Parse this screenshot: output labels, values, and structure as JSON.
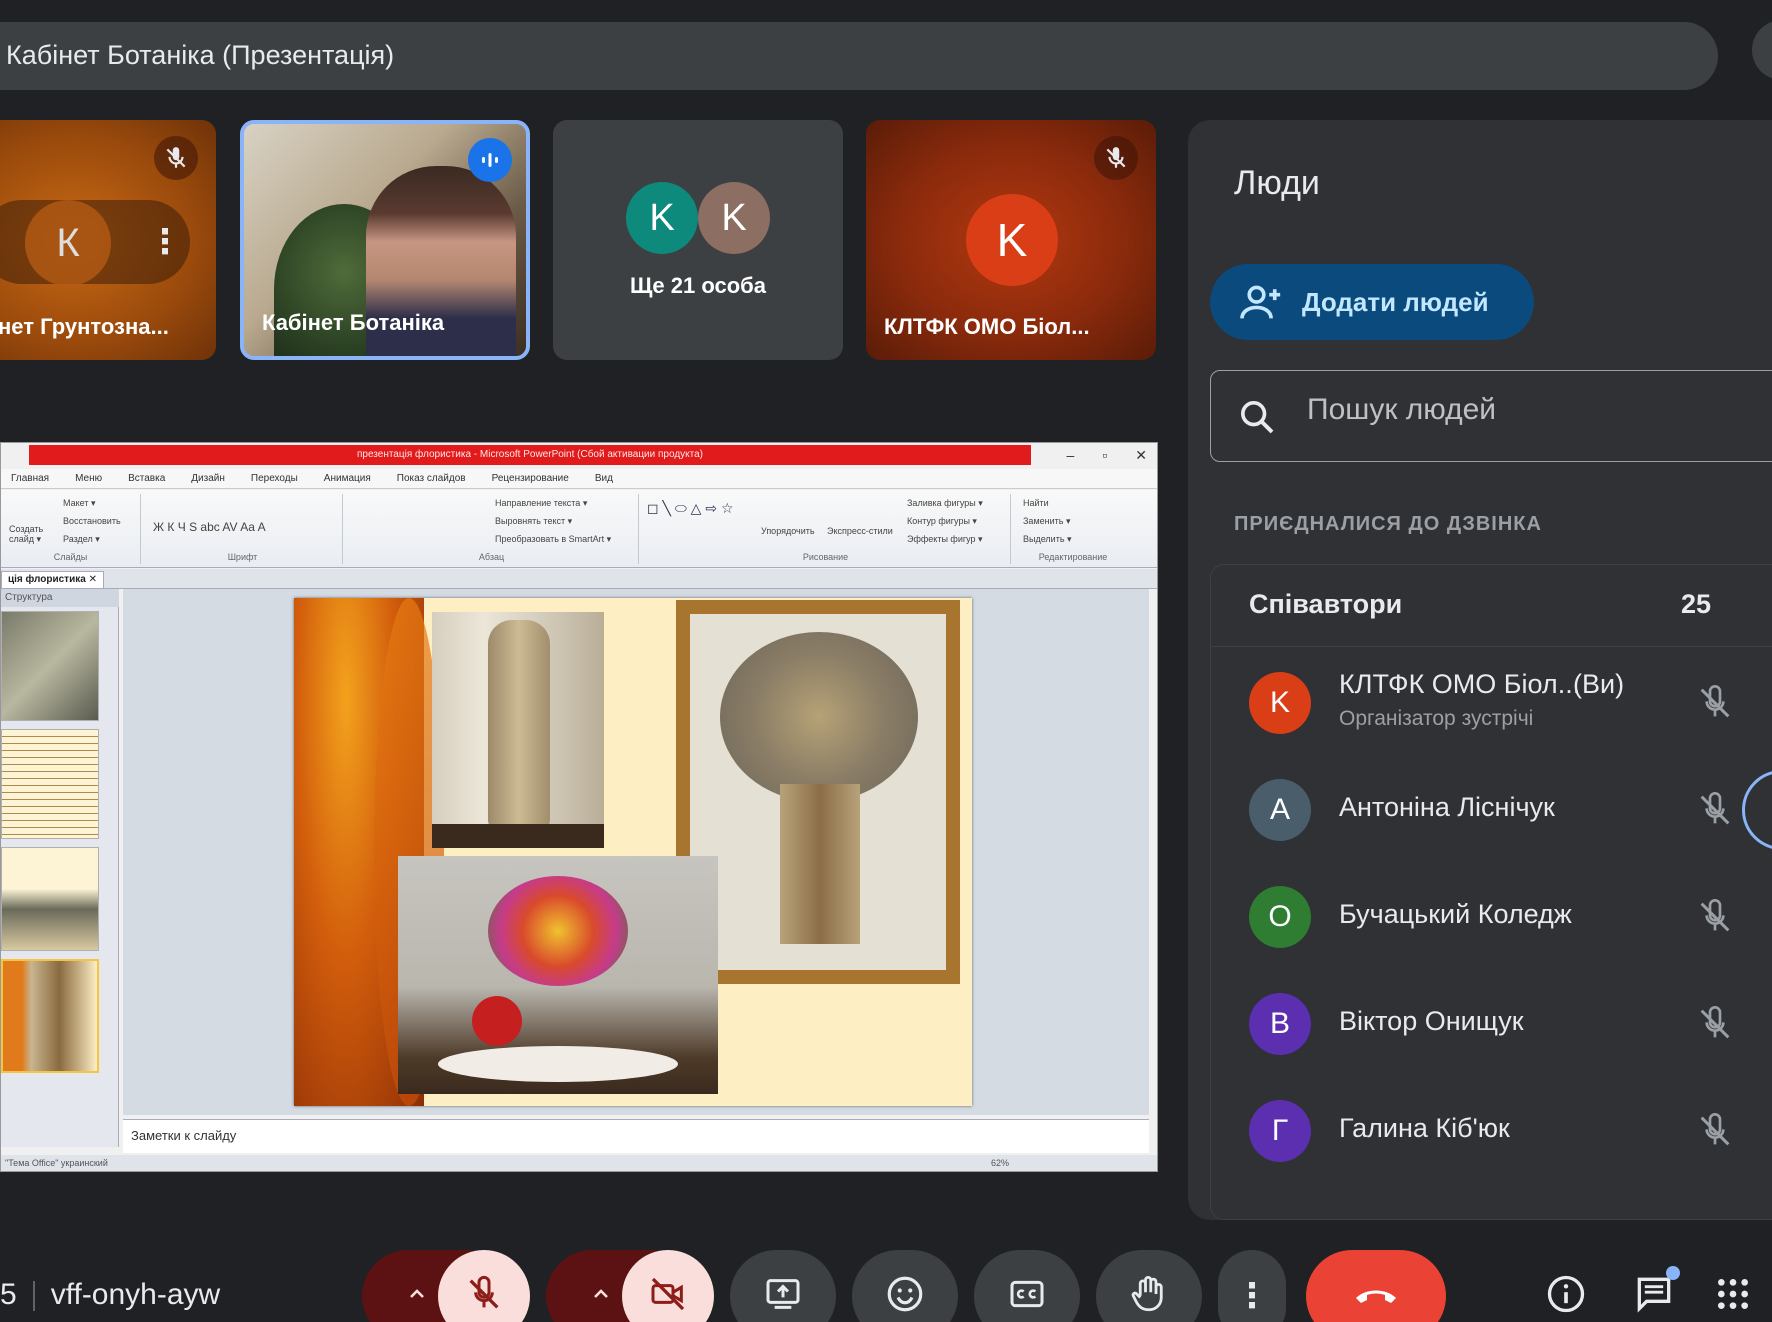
{
  "meeting": {
    "title": "Кабінет Ботаніка (Презентація)",
    "code_prefix": "5",
    "code": "vff-onyh-ayw"
  },
  "tiles": [
    {
      "name": "нет Грунтозна...",
      "avatar_letter": "К"
    },
    {
      "name": "Кабінет Ботаніка"
    },
    {
      "more_text": "Ще 21 особа",
      "avatar_letters": [
        "K",
        "K"
      ]
    },
    {
      "name": "КЛТФК ОМО Біол...",
      "avatar_letter": "K"
    }
  ],
  "presentation": {
    "window_title": "презентація флористика - Microsoft PowerPoint (Сбой активации продукта)",
    "menu_tabs": [
      "Главная",
      "Меню",
      "Вставка",
      "Дизайн",
      "Переходы",
      "Анимация",
      "Показ слайдов",
      "Рецензирование",
      "Вид"
    ],
    "ribbon_groups": [
      "Слайды",
      "Шрифт",
      "Абзац",
      "Рисование",
      "Редактирование"
    ],
    "ribbon_items": {
      "maket": "Макет ▾",
      "vosst": "Восстановить",
      "razdel": "Раздел ▾",
      "create": "Создать слайд ▾",
      "napr": "Направление текста ▾",
      "vyr": "Выровнять текст ▾",
      "smart": "Преобразовать в SmartArt ▾",
      "upor": "Упорядочить",
      "express": "Экспресс-стили",
      "zalivka": "Заливка фигуры ▾",
      "kontur": "Контур фигуры ▾",
      "effekty": "Эффекты фигур ▾",
      "nayti": "Найти",
      "zamenit": "Заменить ▾",
      "vydelit": "Выделить ▾"
    },
    "doc_tab": "ція флористика",
    "pane_tab": "Структура",
    "notes_text": "Заметки к слайду",
    "status_left": "\"Тема Office\"   украинский",
    "zoom": "62%"
  },
  "people_panel": {
    "title": "Люди",
    "add_button": "Додати людей",
    "search_placeholder": "Пошук людей",
    "section_label": "ПРИЄДНАЛИСЯ ДО ДЗВІНКА",
    "group_name": "Співавтори",
    "group_count": "25",
    "you_label": "(Ви)",
    "participants": [
      {
        "letter": "K",
        "name": "КЛТФК ОМО Біол...",
        "role": "Організатор зустрічі",
        "color": "#d93e17"
      },
      {
        "letter": "A",
        "name": "Антоніна Ліснічук",
        "color": "#4a5d6b"
      },
      {
        "letter": "O",
        "name": "Бучацький Коледж",
        "color": "#2e7d32"
      },
      {
        "letter": "B",
        "name": "Віктор Онищук",
        "color": "#5b2fb0"
      },
      {
        "letter": "Г",
        "name": "Галина Кіб'юк",
        "color": "#5b2fb0"
      }
    ]
  },
  "controls": {
    "mic": "mic-off",
    "camera": "camera-off",
    "present": "present-now",
    "emoji": "emoji",
    "captions": "captions",
    "raise_hand": "raise-hand",
    "more": "more-options",
    "end_call": "leave-call",
    "info": "meeting-details",
    "chat": "chat",
    "activities": "activities"
  },
  "colors": {
    "background": "#202124",
    "surface": "#303134",
    "accent_blue": "#8ab4f8",
    "end_call_red": "#ea4335",
    "mic_off_fill": "#f9dedc"
  }
}
